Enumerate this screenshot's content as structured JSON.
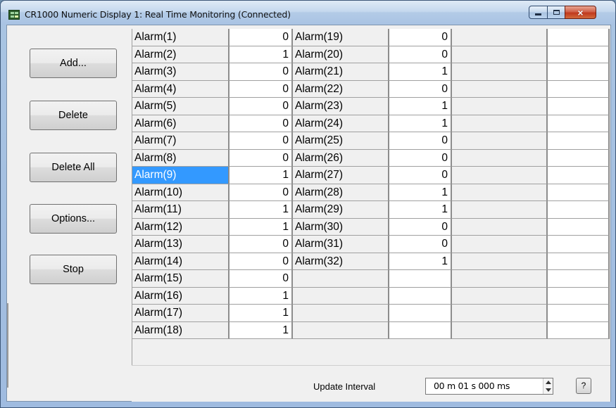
{
  "window": {
    "title": "CR1000 Numeric Display 1: Real Time Monitoring (Connected)",
    "icon": "numeric-display-app-icon",
    "controls": {
      "minimize": "minimize-icon",
      "maximize": "maximize-icon",
      "close": "×"
    }
  },
  "buttons": {
    "add": "Add...",
    "delete": "Delete",
    "delete_all": "Delete All",
    "options": "Options...",
    "stop": "Stop"
  },
  "grid": {
    "column1": [
      {
        "name": "Alarm(1)",
        "value": "0"
      },
      {
        "name": "Alarm(2)",
        "value": "1"
      },
      {
        "name": "Alarm(3)",
        "value": "0"
      },
      {
        "name": "Alarm(4)",
        "value": "0"
      },
      {
        "name": "Alarm(5)",
        "value": "0"
      },
      {
        "name": "Alarm(6)",
        "value": "0"
      },
      {
        "name": "Alarm(7)",
        "value": "0"
      },
      {
        "name": "Alarm(8)",
        "value": "0"
      },
      {
        "name": "Alarm(9)",
        "value": "1"
      },
      {
        "name": "Alarm(10)",
        "value": "0"
      },
      {
        "name": "Alarm(11)",
        "value": "1"
      },
      {
        "name": "Alarm(12)",
        "value": "1"
      },
      {
        "name": "Alarm(13)",
        "value": "0"
      },
      {
        "name": "Alarm(14)",
        "value": "0"
      },
      {
        "name": "Alarm(15)",
        "value": "0"
      },
      {
        "name": "Alarm(16)",
        "value": "1"
      },
      {
        "name": "Alarm(17)",
        "value": "1"
      },
      {
        "name": "Alarm(18)",
        "value": "1"
      }
    ],
    "column2": [
      {
        "name": "Alarm(19)",
        "value": "0"
      },
      {
        "name": "Alarm(20)",
        "value": "0"
      },
      {
        "name": "Alarm(21)",
        "value": "1"
      },
      {
        "name": "Alarm(22)",
        "value": "0"
      },
      {
        "name": "Alarm(23)",
        "value": "1"
      },
      {
        "name": "Alarm(24)",
        "value": "1"
      },
      {
        "name": "Alarm(25)",
        "value": "0"
      },
      {
        "name": "Alarm(26)",
        "value": "0"
      },
      {
        "name": "Alarm(27)",
        "value": "0"
      },
      {
        "name": "Alarm(28)",
        "value": "1"
      },
      {
        "name": "Alarm(29)",
        "value": "1"
      },
      {
        "name": "Alarm(30)",
        "value": "0"
      },
      {
        "name": "Alarm(31)",
        "value": "0"
      },
      {
        "name": "Alarm(32)",
        "value": "1"
      }
    ],
    "selected": "Alarm(9)",
    "selection_color": "#3399ff"
  },
  "footer": {
    "update_interval_label": "Update Interval",
    "update_interval_value": "00 m 01 s 000 ms",
    "help_label": "?"
  }
}
